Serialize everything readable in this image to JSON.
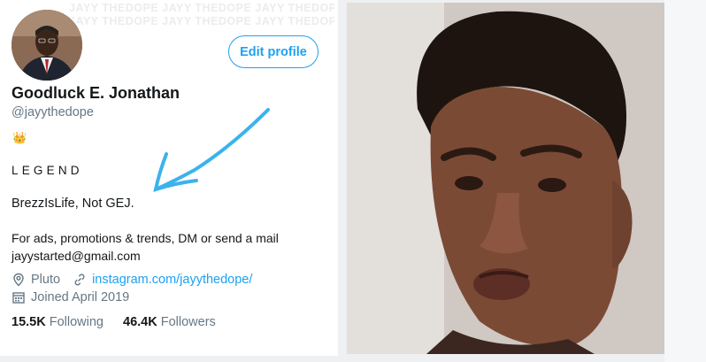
{
  "profile": {
    "watermark_text": "JAYY THEDOPE JAYY THEDOPE JAYY THEDOPE JAYY THEDOPE JAYY THEDOPE",
    "edit_button": "Edit profile",
    "display_name": "Goodluck E. Jonathan",
    "handle": "@jayythedope",
    "crown_emoji": "👑",
    "legend_text": "LEGEND",
    "bio_line1": "BrezzIsLife, Not GEJ.",
    "bio_line2": "For ads, promotions & trends, DM or send a mail",
    "bio_line3": "jayystarted@gmail.com",
    "location": "Pluto",
    "website": "instagram.com/jayythedope/",
    "joined": "Joined April 2019",
    "following_count": "15.5K",
    "following_label": "Following",
    "followers_count": "46.4K",
    "followers_label": "Followers"
  },
  "colors": {
    "accent": "#1da1f2",
    "muted": "#657786",
    "text": "#14171a",
    "arrow": "#3bb3ec"
  },
  "icons": [
    "location-icon",
    "link-icon",
    "calendar-icon"
  ]
}
